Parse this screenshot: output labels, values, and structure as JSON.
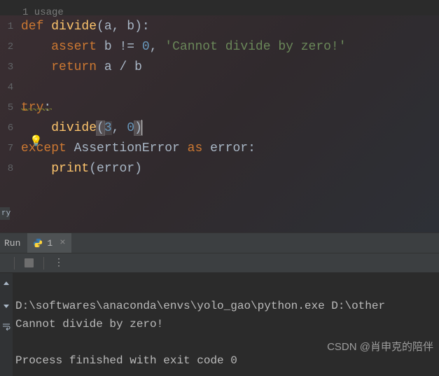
{
  "usage_hint": "1 usage",
  "gutter": [
    "1",
    "2",
    "3",
    "4",
    "5",
    "6",
    "7",
    "8"
  ],
  "code": {
    "line1": {
      "kw": "def",
      "fn": "divide",
      "p1": "a",
      "p2": "b"
    },
    "line2": {
      "kw": "assert",
      "var": "b",
      "op": "!= ",
      "num": "0",
      "str": "'Cannot divide by zero!'"
    },
    "line3": {
      "kw": "return",
      "expr_a": "a",
      "expr_op": " / ",
      "expr_b": "b"
    },
    "line5": {
      "kw": "try"
    },
    "line6": {
      "fn": "divide",
      "arg1": "3",
      "arg2": "0"
    },
    "line7": {
      "kw1": "except",
      "cls": "AssertionError",
      "kw2": "as",
      "var": "error"
    },
    "line8": {
      "fn": "print",
      "var": "error"
    }
  },
  "left_divider": "ry",
  "run_label": "Run",
  "tab": {
    "name": "1",
    "close": "×"
  },
  "toolbar": {
    "stop": "stop",
    "menu": "⋮"
  },
  "console": {
    "line1": "D:\\softwares\\anaconda\\envs\\yolo_gao\\python.exe D:\\other",
    "line2": "Cannot divide by zero!",
    "line3": "",
    "line4": "Process finished with exit code 0"
  },
  "watermark": "CSDN @肖申克的陪伴"
}
